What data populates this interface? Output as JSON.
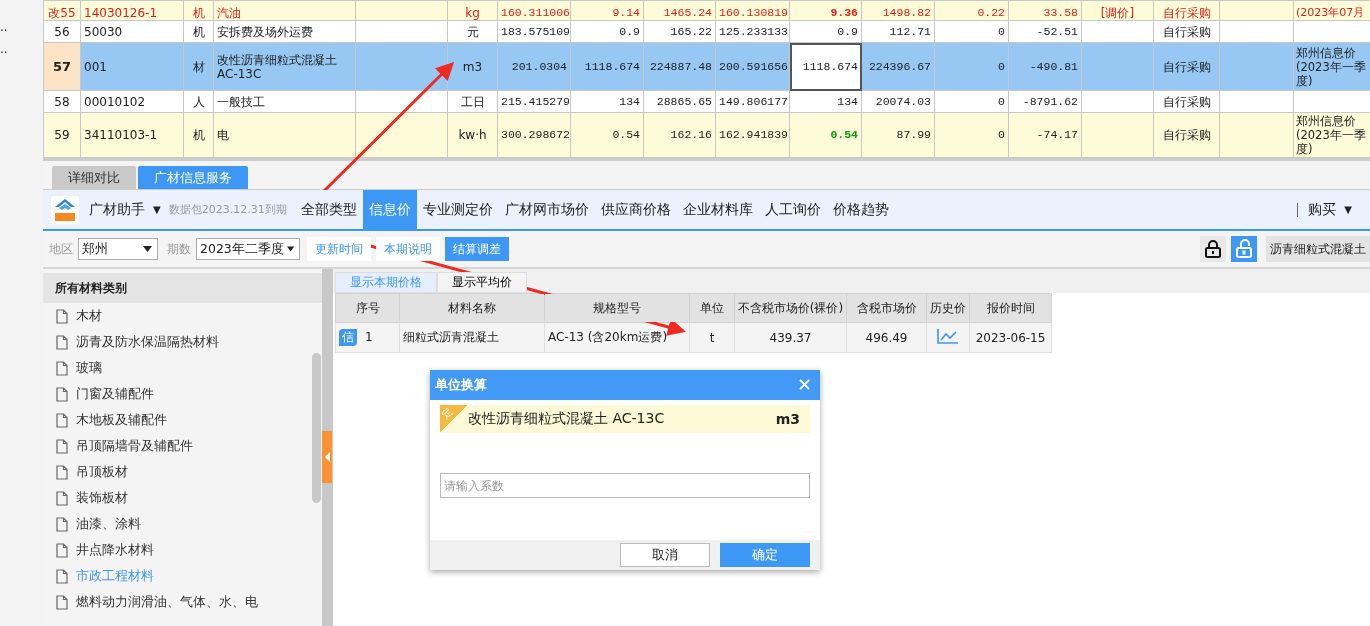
{
  "edge_marks": [
    "..",
    ".."
  ],
  "grid": {
    "rows": [
      {
        "marker": "改",
        "no": "55",
        "code": "14030126-1",
        "category": "机",
        "name": "汽油",
        "unit": "kg",
        "column_7": "160.311006",
        "column_8": "9.14",
        "column_9": "1465.24",
        "column_10": "160.130819",
        "column_11": "9.36",
        "column_12": "1498.82",
        "column_13": "0.22",
        "column_14": "33.58",
        "column_15": "[调价]",
        "column_16": "自行采购",
        "column_18": "(2023年07月",
        "modified": true,
        "shaded": true,
        "selected": false,
        "quantity_bold": true,
        "quantity_matched": false,
        "quantity_focused": false
      },
      {
        "no": "56",
        "code": "50030",
        "category": "机",
        "name": "安拆费及场外运费",
        "unit": "元",
        "column_7": "183.575109",
        "column_8": "0.9",
        "column_9": "165.22",
        "column_10": "125.233133",
        "column_11": "0.9",
        "column_12": "112.71",
        "column_13": "0",
        "column_14": "-52.51",
        "column_16": "自行采购",
        "modified": false,
        "shaded": false,
        "selected": false,
        "quantity_bold": false,
        "quantity_matched": false,
        "quantity_focused": false
      },
      {
        "no": "57",
        "code": "001",
        "category": "材",
        "name": "改性沥青细粒式混凝土\nAC-13C",
        "unit": "m3",
        "column_7": "201.0304",
        "column_8": "1118.674",
        "column_9": "224887.48",
        "column_10": "200.591656",
        "column_11": "1118.674",
        "column_12": "224396.67",
        "column_13": "0",
        "column_14": "-490.81",
        "column_16": "自行采购",
        "column_18": "郑州信息价(2023年一季度)",
        "modified": false,
        "shaded": false,
        "selected": true,
        "quantity_bold": false,
        "quantity_matched": false,
        "quantity_focused": true
      },
      {
        "no": "58",
        "code": "00010102",
        "category": "人",
        "name": "一般技工",
        "unit": "工日",
        "column_7": "215.415279",
        "column_8": "134",
        "column_9": "28865.65",
        "column_10": "149.806177",
        "column_11": "134",
        "column_12": "20074.03",
        "column_13": "0",
        "column_14": "-8791.62",
        "column_16": "自行采购",
        "modified": false,
        "shaded": false,
        "selected": false,
        "quantity_bold": false,
        "quantity_matched": false,
        "quantity_focused": false
      },
      {
        "no": "59",
        "code": "34110103-1",
        "category": "机",
        "name": "电",
        "unit": "kw·h",
        "column_7": "300.298672",
        "column_8": "0.54",
        "column_9": "162.16",
        "column_10": "162.941839",
        "column_11": "0.54",
        "column_12": "87.99",
        "column_13": "0",
        "column_14": "-74.17",
        "column_16": "自行采购",
        "column_18": "郑州信息价(2023年一季度)",
        "modified": false,
        "shaded": true,
        "selected": false,
        "quantity_bold": true,
        "quantity_matched": true,
        "quantity_focused": false
      }
    ]
  },
  "tabs": [
    {
      "label": "详细对比",
      "selected": false
    },
    {
      "label": "广材信息服务",
      "selected": true
    }
  ],
  "toolbar": {
    "brand": "广材助手",
    "brand_caret": "▼",
    "package": "数据包2023.12.31到期",
    "nav": [
      {
        "label": "全部类型",
        "selected": false
      },
      {
        "label": "信息价",
        "selected": true
      },
      {
        "label": "专业测定价",
        "selected": false
      },
      {
        "label": "广材网市场价",
        "selected": false
      },
      {
        "label": "供应商价格",
        "selected": false
      },
      {
        "label": "企业材料库",
        "selected": false
      },
      {
        "label": "人工询价",
        "selected": false
      },
      {
        "label": "价格趋势",
        "selected": false
      }
    ],
    "buy": "购买",
    "buy_caret": "▼"
  },
  "filters": {
    "region_label": "地区",
    "region": "郑州",
    "period_label": "期数",
    "period": "2023年二季度",
    "buttons": [
      {
        "label": "更新时间",
        "selected": false
      },
      {
        "label": "本期说明",
        "selected": false
      },
      {
        "label": "结算调差",
        "selected": true
      }
    ],
    "locked": false,
    "keyword": "沥青细粒式混凝土"
  },
  "categories": {
    "title": "所有材料类别",
    "items": [
      {
        "label": "木材",
        "selected": false
      },
      {
        "label": "沥青及防水保温隔热材料",
        "selected": false
      },
      {
        "label": "玻璃",
        "selected": false
      },
      {
        "label": "门窗及辅配件",
        "selected": false
      },
      {
        "label": "木地板及辅配件",
        "selected": false
      },
      {
        "label": "吊顶隔墙骨及辅配件",
        "selected": false
      },
      {
        "label": "吊顶板材",
        "selected": false
      },
      {
        "label": "装饰板材",
        "selected": false
      },
      {
        "label": "油漆、涂料",
        "selected": false
      },
      {
        "label": "井点降水材料",
        "selected": false
      },
      {
        "label": "市政工程材料",
        "selected": true
      },
      {
        "label": "燃料动力润滑油、气体、水、电",
        "selected": false
      }
    ]
  },
  "price_tabs": [
    {
      "label": "显示本期价格",
      "selected": true
    },
    {
      "label": "显示平均价",
      "selected": false
    }
  ],
  "prices": {
    "columns": [
      "序号",
      "材料名称",
      "规格型号",
      "单位",
      "不含税市场价(裸价)",
      "含税市场价",
      "历史价",
      "报价时间"
    ],
    "rows": [
      {
        "badge": "信",
        "no": "1",
        "name": "细粒式沥青混凝土",
        "spec": "AC-13 (含20km运费)",
        "unit": "t",
        "price_ex_tax": "439.37",
        "price_inc_tax": "496.49",
        "date": "2023-06-15"
      }
    ]
  },
  "dialog": {
    "title": "单位换算",
    "close": "✕",
    "item": {
      "badge": "定",
      "name": "改性沥青细粒式混凝土 AC-13C",
      "unit": "m3"
    },
    "placeholder": "请输入系数",
    "buttons": [
      {
        "label": "取消",
        "kind": "secondary"
      },
      {
        "label": "确定",
        "kind": "primary"
      }
    ]
  }
}
